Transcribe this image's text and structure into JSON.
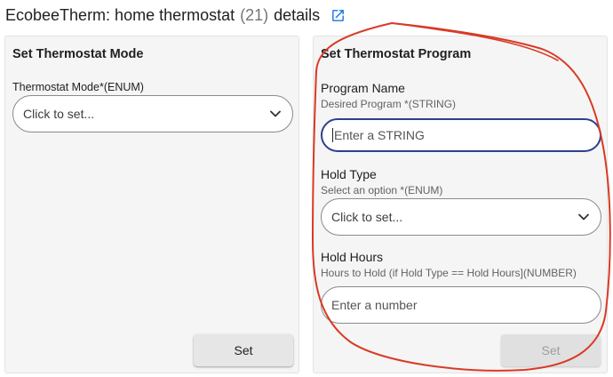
{
  "header": {
    "title_main": "EcobeeTherm: home thermostat",
    "title_count": "(21)",
    "title_suffix": "details",
    "icon": "external-link-icon"
  },
  "mode_card": {
    "title": "Set Thermostat Mode",
    "field_label": "Thermostat Mode*(ENUM)",
    "select_placeholder": "Click to set...",
    "set_button": "Set"
  },
  "program_card": {
    "title": "Set Thermostat Program",
    "program_name_label": "Program Name",
    "program_name_sub": "Desired Program *(STRING)",
    "program_name_placeholder": "Enter a STRING",
    "hold_type_label": "Hold Type",
    "hold_type_sub": "Select an option *(ENUM)",
    "hold_type_placeholder": "Click to set...",
    "hold_hours_label": "Hold Hours",
    "hold_hours_sub": "Hours to Hold (if Hold Type == Hold Hours](NUMBER)",
    "hold_hours_placeholder": "Enter a number",
    "set_button": "Set",
    "set_button_disabled": true
  },
  "colors": {
    "focus_border": "#2f3f8f",
    "annotation_stroke": "#d93a25",
    "card_bg": "#f5f5f5"
  }
}
